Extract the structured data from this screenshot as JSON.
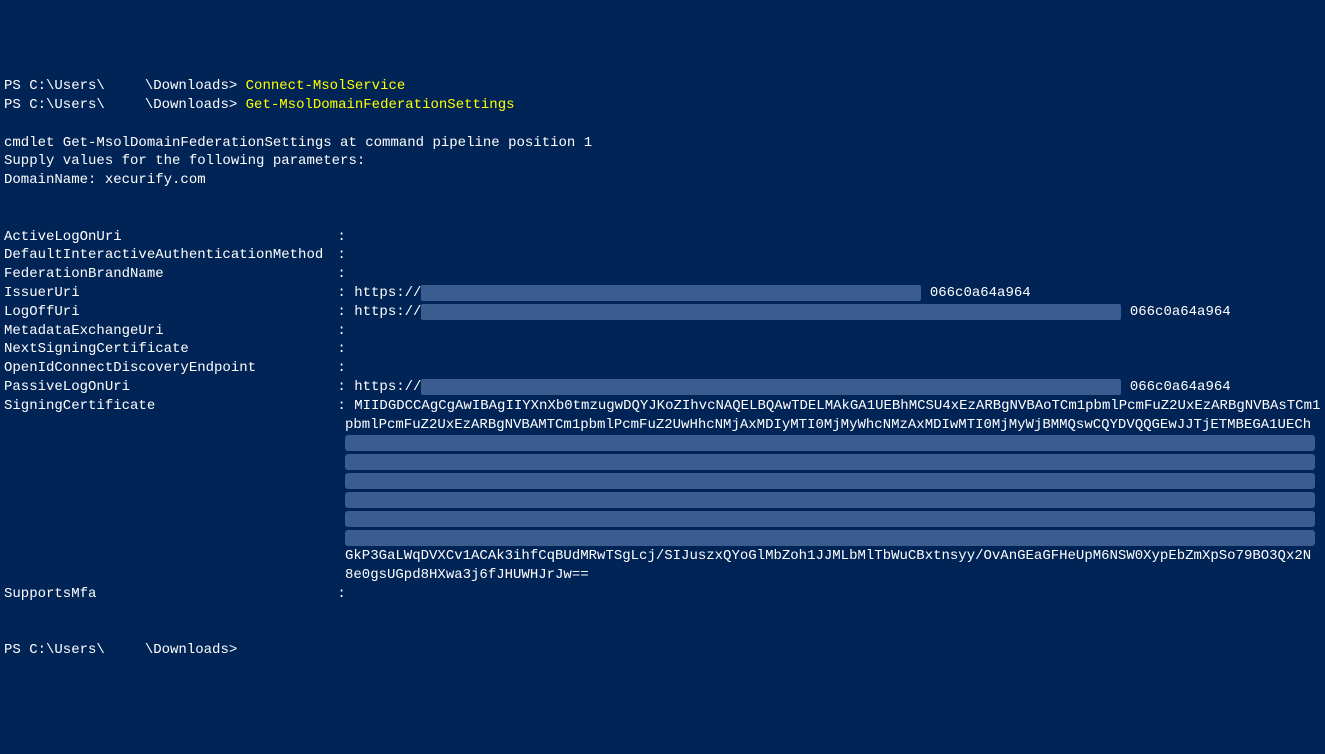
{
  "prompt1": {
    "prefix": "PS C:\\Users\\",
    "redacted_user": "     ",
    "path_suffix": "\\Downloads> ",
    "command": "Connect-MsolService"
  },
  "prompt2": {
    "prefix": "PS C:\\Users\\",
    "redacted_user": "     ",
    "path_suffix": "\\Downloads> ",
    "command": "Get-MsolDomainFederationSettings"
  },
  "cmdlet_info": {
    "line1": "cmdlet Get-MsolDomainFederationSettings at command pipeline position 1",
    "line2": "Supply values for the following parameters:",
    "line3": "DomainName: xecurify.com"
  },
  "properties": {
    "activeLogOnUri": {
      "label": "ActiveLogOnUri",
      "value": ""
    },
    "defaultAuth": {
      "label": "DefaultInteractiveAuthenticationMethod",
      "value": ""
    },
    "federationBrand": {
      "label": "FederationBrandName",
      "value": ""
    },
    "issuerUri": {
      "label": "IssuerUri",
      "value_prefix": "https://",
      "value_suffix": "066c0a64a964"
    },
    "logOffUri": {
      "label": "LogOffUri",
      "value_prefix": "https://",
      "value_suffix": "066c0a64a964"
    },
    "metadataExchange": {
      "label": "MetadataExchangeUri",
      "value": ""
    },
    "nextSigningCert": {
      "label": "NextSigningCertificate",
      "value": ""
    },
    "openIdConnect": {
      "label": "OpenIdConnectDiscoveryEndpoint",
      "value": ""
    },
    "passiveLogOn": {
      "label": "PassiveLogOnUri",
      "value_prefix": "https://",
      "value_suffix": "066c0a64a964"
    },
    "signingCert": {
      "label": "SigningCertificate",
      "line1": "MIIDGDCCAgCgAwIBAgIIYXnXb0tmzugwDQYJKoZIhvcNAQELBQAwTDELMAkGA1UEBhMCSU4xEzARBgNVBAoTCm1pbmlPcmFuZ2UxEzARBgNVBAsTCm1",
      "line2": "pbmlPcmFuZ2UxEzARBgNVBAMTCm1pbmlPcmFuZ2UwHhcNMjAxMDIyMTI0MjMyWhcNMzAxMDIwMTI0MjMyWjBMMQswCQYDVQQGEwJJTjETMBEGA1UECh",
      "line3": "GkP3GaLWqDVXCv1ACAk3ihfCqBUdMRwTSgLcj/SIJuszxQYoGlMbZoh1JJMLbMlTbWuCBxtnsyy/OvAnGEaGFHeUpM6NSW0XypEbZmXpSo79BO3Qx2N",
      "line4": "8e0gsUGpd8HXwa3j6fJHUWHJrJw=="
    },
    "supportsMfa": {
      "label": "SupportsMfa",
      "value": ""
    }
  },
  "prompt3": {
    "prefix": "PS C:\\Users\\",
    "redacted_user": "     ",
    "path_suffix": "\\Downloads>"
  },
  "separator": " : "
}
